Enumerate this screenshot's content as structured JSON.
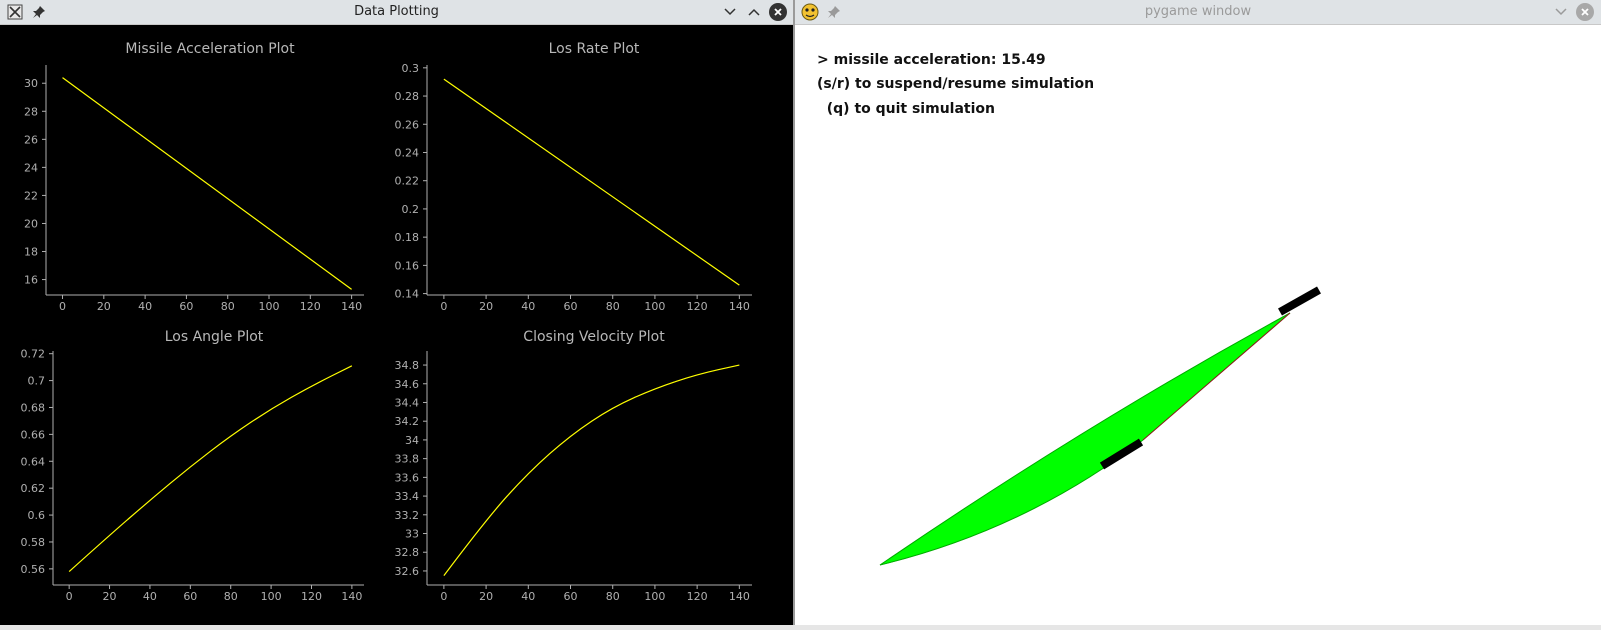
{
  "left_window": {
    "title": "Data Plotting",
    "app_icon": "matplotlib-x-icon",
    "pin_icon": "pin-icon",
    "minimize_label": "⌄",
    "maximize_label": "⌃",
    "close_label": "✕"
  },
  "right_window": {
    "title": "pygame window",
    "app_icon": "pygame-snake-icon",
    "pin_icon": "pin-icon",
    "minimize_label": "⌄",
    "close_label": "✕"
  },
  "hud": {
    "line1": "> missile acceleration: 15.49",
    "line2": "(s/r) to suspend/resume simulation",
    "line3": "  (q) to quit simulation"
  },
  "colors": {
    "plot_line": "#ffff00",
    "plot_bg": "#000000",
    "axis": "#b0b0b0",
    "trail": "#00ff00",
    "object": "#000000"
  },
  "chart_data": [
    {
      "type": "line",
      "title": "Missile Acceleration Plot",
      "x": [
        0,
        140
      ],
      "y": [
        30.4,
        15.3
      ],
      "xlim": [
        -8,
        146
      ],
      "ylim": [
        14.9,
        31.3
      ],
      "xticks": [
        "0",
        "20",
        "40",
        "60",
        "80",
        "100",
        "120",
        "140"
      ],
      "yticks": [
        "16",
        "18",
        "20",
        "22",
        "24",
        "26",
        "28",
        "30"
      ],
      "shape": "linear"
    },
    {
      "type": "line",
      "title": "Los Rate Plot",
      "x": [
        0,
        140
      ],
      "y": [
        0.292,
        0.146
      ],
      "xlim": [
        -8,
        146
      ],
      "ylim": [
        0.139,
        0.302
      ],
      "xticks": [
        "0",
        "20",
        "40",
        "60",
        "80",
        "100",
        "120",
        "140"
      ],
      "yticks": [
        "0.14",
        "0.16",
        "0.18",
        "0.2",
        "0.22",
        "0.24",
        "0.26",
        "0.28",
        "0.3"
      ],
      "shape": "linear"
    },
    {
      "type": "line",
      "title": "Los Angle Plot",
      "x": [
        0,
        20,
        40,
        60,
        80,
        100,
        120,
        140
      ],
      "y": [
        0.558,
        0.585,
        0.611,
        0.636,
        0.659,
        0.679,
        0.696,
        0.711
      ],
      "xlim": [
        -8,
        146
      ],
      "ylim": [
        0.548,
        0.722
      ],
      "xticks": [
        "0",
        "20",
        "40",
        "60",
        "80",
        "100",
        "120",
        "140"
      ],
      "yticks": [
        "0.56",
        "0.58",
        "0.6",
        "0.62",
        "0.64",
        "0.66",
        "0.68",
        "0.7",
        "0.72"
      ],
      "shape": "curve"
    },
    {
      "type": "line",
      "title": "Closing Velocity Plot",
      "x": [
        0,
        20,
        40,
        60,
        80,
        100,
        120,
        140
      ],
      "y": [
        32.55,
        33.15,
        33.65,
        34.05,
        34.35,
        34.55,
        34.7,
        34.8
      ],
      "xlim": [
        -8,
        146
      ],
      "ylim": [
        32.45,
        34.95
      ],
      "xticks": [
        "0",
        "20",
        "40",
        "60",
        "80",
        "100",
        "120",
        "140"
      ],
      "yticks": [
        "32.6",
        "32.8",
        "33",
        "33.2",
        "33.4",
        "33.6",
        "33.8",
        "34",
        "34.2",
        "34.4",
        "34.6",
        "34.8"
      ],
      "shape": "curve"
    }
  ]
}
